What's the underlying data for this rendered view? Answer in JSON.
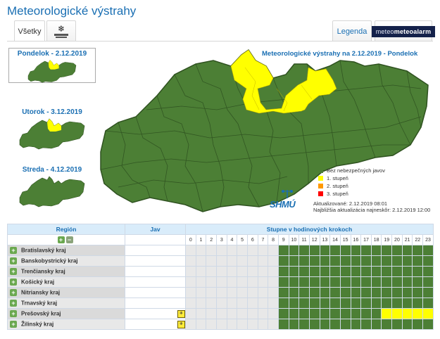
{
  "page": {
    "title": "Meteorologické výstrahy"
  },
  "tabs": {
    "all_label": "Všetky",
    "legend_label": "Legenda",
    "meteoalarm_label": "meteoalarm",
    "meteoalarm_sub": "meteo"
  },
  "thumbnails": [
    {
      "label": "Pondelok - 2.12.2019",
      "selected": true
    },
    {
      "label": "Utorok - 3.12.2019",
      "selected": false
    },
    {
      "label": "Streda - 4.12.2019",
      "selected": false
    }
  ],
  "map": {
    "title": "Meteorologické výstrahy na 2.12.2019 - Pondelok"
  },
  "legend": {
    "items": [
      {
        "label": "Bez nebezpečných javov",
        "color": "#4c7f35"
      },
      {
        "label": "1. stupeň",
        "color": "#ffff00"
      },
      {
        "label": "2. stupeň",
        "color": "#ff9900"
      },
      {
        "label": "3. stupeň",
        "color": "#ff0000"
      }
    ]
  },
  "brand": {
    "shmu": "SHMÚ"
  },
  "updates": {
    "updated": "Aktualizované: 2.12.2019 08:01",
    "next": "Najbližšia aktualizácia najneskôr: 2.12.2019 12:00"
  },
  "table": {
    "headers": {
      "region": "Región",
      "jav": "Jav",
      "steps": "Stupne v hodinových krokoch"
    },
    "hours": [
      "0",
      "1",
      "2",
      "3",
      "4",
      "5",
      "6",
      "7",
      "8",
      "9",
      "10",
      "11",
      "12",
      "13",
      "14",
      "15",
      "16",
      "17",
      "18",
      "19",
      "20",
      "21",
      "22",
      "23"
    ],
    "rows": [
      {
        "name": "Bratislavský kraj",
        "jav": false,
        "yellow_from": null
      },
      {
        "name": "Banskobystrický kraj",
        "jav": false,
        "yellow_from": null
      },
      {
        "name": "Trenčiansky kraj",
        "jav": false,
        "yellow_from": null
      },
      {
        "name": "Košický kraj",
        "jav": false,
        "yellow_from": null
      },
      {
        "name": "Nitriansky kraj",
        "jav": false,
        "yellow_from": null
      },
      {
        "name": "Trnavský kraj",
        "jav": false,
        "yellow_from": null
      },
      {
        "name": "Prešovský kraj",
        "jav": true,
        "yellow_from": 19
      },
      {
        "name": "Žilinský kraj",
        "jav": true,
        "yellow_from": null
      }
    ],
    "green_from": 9,
    "colors": {
      "empty": "#e8e8e8",
      "green": "#4c7f35",
      "yellow": "#ffff00"
    }
  }
}
